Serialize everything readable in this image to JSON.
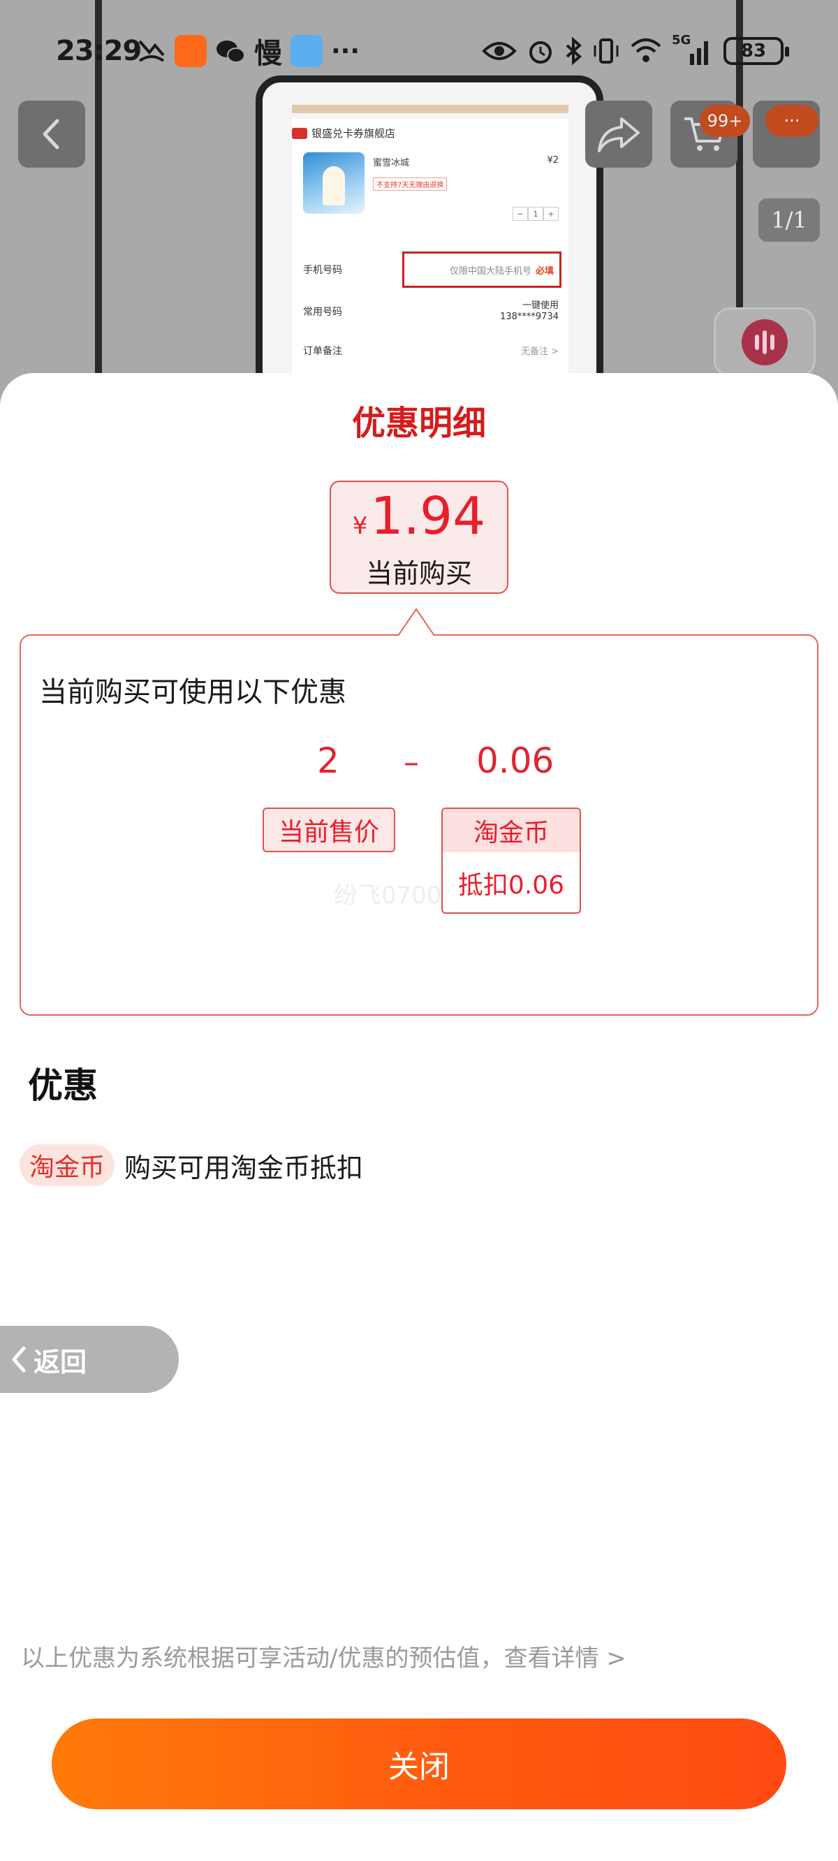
{
  "status_bar": {
    "time": "23:29",
    "slow_label": "慢",
    "overflow": "···",
    "network": "5G",
    "battery": "83"
  },
  "background": {
    "store_name": "银盛兑卡券旗舰店",
    "product_name": "蜜雪冰城",
    "product_price": "¥2",
    "product_tag": "不支持7天无理由退换",
    "quantity": "1",
    "phone_label": "手机号码",
    "phone_placeholder": "仅限中国大陆手机号",
    "phone_required": "必填",
    "common_label": "常用号码",
    "common_action": "一键使用",
    "common_number": "138****9734",
    "note_label": "订单备注",
    "note_value": "无备注 >",
    "cart_badge": "99+",
    "more_badge": "···",
    "page_indicator": "1/1"
  },
  "sheet": {
    "title": "优惠明细",
    "price_card": {
      "currency": "¥",
      "amount": "1.94",
      "label": "当前购买"
    },
    "detail": {
      "heading": "当前购买可使用以下优惠",
      "base_value": "2",
      "operator": "–",
      "discount_value": "0.06",
      "base_label": "当前售价",
      "discount_title": "淘金币",
      "discount_desc": "抵扣0.06",
      "watermark": "纷飞0700"
    },
    "promos_title": "优惠",
    "promos": [
      {
        "tag": "淘金币",
        "text": "购买可用淘金币抵扣"
      }
    ],
    "back_label": "返回",
    "disclaimer": "以上优惠为系统根据可享活动/优惠的预估值，查看详情 >",
    "close_label": "关闭"
  },
  "colors": {
    "accent_red": "#d41c1c",
    "price_red": "#e81e2a",
    "button_orange_start": "#ff7a0a",
    "button_orange_end": "#ff4a12"
  }
}
